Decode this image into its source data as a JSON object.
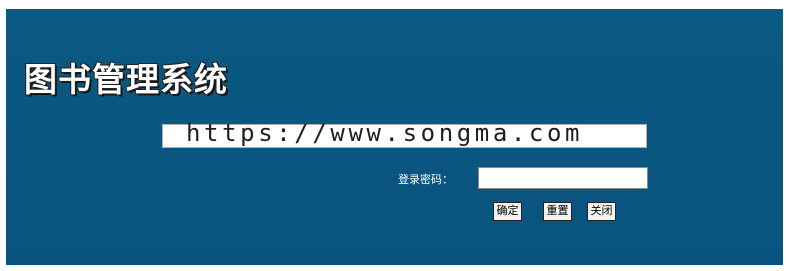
{
  "app": {
    "title": "图书管理系统",
    "watermark_url": "https://www.songma.com"
  },
  "login": {
    "password_label": "登录密码：",
    "password_value": "",
    "buttons": {
      "confirm": "确定",
      "reset": "重置",
      "close": "关闭"
    }
  },
  "colors": {
    "panel_background": "#0a5680",
    "page_background": "#ffffff",
    "title_text": "#ffffff"
  }
}
